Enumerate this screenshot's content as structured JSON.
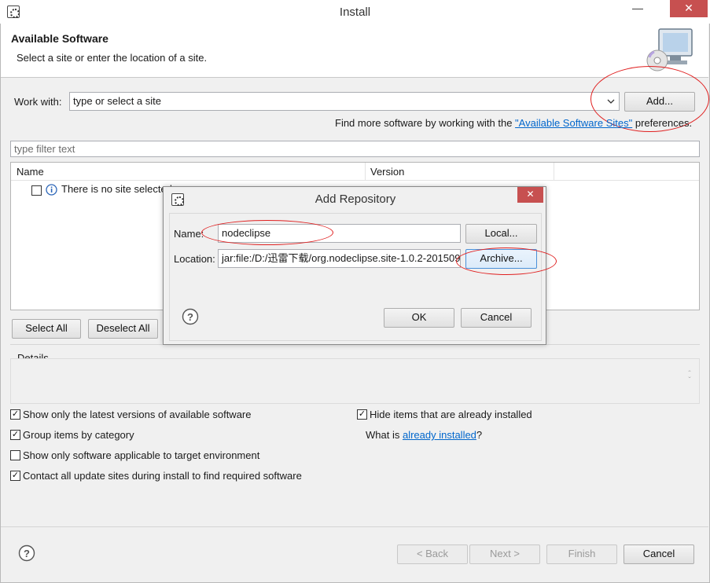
{
  "window": {
    "title": "Install"
  },
  "header": {
    "title": "Available Software",
    "description": "Select a site or enter the location of a site."
  },
  "work_with": {
    "label": "Work with:",
    "placeholder": "type or select a site",
    "add_label": "Add...",
    "find_more_prefix": "Find more software by working with the ",
    "find_more_link": "\"Available Software Sites\"",
    "find_more_suffix": " preferences."
  },
  "filter": {
    "placeholder": "type filter text"
  },
  "table": {
    "columns": [
      "Name",
      "Version"
    ],
    "rows": [
      {
        "name": "There is no site selected."
      }
    ]
  },
  "buttons": {
    "select_all": "Select All",
    "deselect_all": "Deselect All"
  },
  "details": {
    "label": "Details"
  },
  "options": {
    "latest_versions": "Show only the latest versions of available software",
    "group_by_category": "Group items by category",
    "applicable_only": "Show only software applicable to target environment",
    "contact_sites": "Contact all update sites during install to find required software",
    "hide_installed": "Hide items that are already installed",
    "what_is_prefix": "What is ",
    "what_is_link": "already installed",
    "what_is_suffix": "?"
  },
  "footer": {
    "back": "< Back",
    "next": "Next >",
    "finish": "Finish",
    "cancel": "Cancel"
  },
  "dialog": {
    "title": "Add Repository",
    "name_label": "Name:",
    "name_value": "nodeclipse",
    "local_label": "Local...",
    "location_label": "Location:",
    "location_value": "jar:file:/D:/迅雷下载/org.nodeclipse.site-1.0.2-201509",
    "archive_label": "Archive...",
    "ok_label": "OK",
    "cancel_label": "Cancel"
  },
  "colors": {
    "annotation": "#e02020",
    "link": "#0066cc",
    "close_button": "#c75050"
  },
  "icons": [
    "install-icon",
    "minimize-icon",
    "close-icon",
    "monitor-cd-icon",
    "chevron-down-icon",
    "info-icon",
    "help-icon",
    "spinner-icon"
  ]
}
